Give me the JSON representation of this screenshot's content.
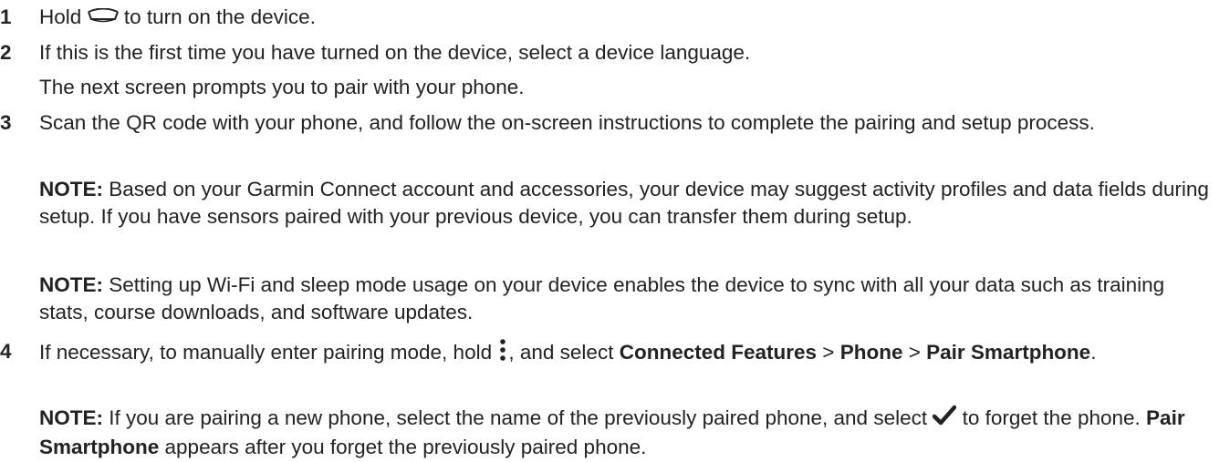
{
  "steps": [
    {
      "number": "1",
      "before_icon": "Hold",
      "icon": "power-button-icon",
      "after_icon": "to turn on the device."
    },
    {
      "number": "2",
      "text": "If this is the first time you have turned on the device, select a device language.",
      "followup": "The next screen prompts you to pair with your phone."
    },
    {
      "number": "3",
      "text": "Scan the QR code with your phone, and follow the on-screen instructions to complete the pairing and setup process.",
      "notes": [
        {
          "label": "NOTE:",
          "text": "Based on your Garmin Connect account and accessories, your device may suggest activity profiles and data fields during setup. If you have sensors paired with your previous device, you can transfer them during setup."
        },
        {
          "label": "NOTE:",
          "text": "Setting up Wi-Fi and sleep mode usage on your device enables the device to sync with all your data such as training stats, course downloads, and software updates."
        }
      ]
    },
    {
      "number": "4",
      "before_icon": "If necessary, to manually enter pairing mode, hold",
      "icon": "menu-dots-icon",
      "mid_text": ", and select",
      "menu_path": [
        "Connected Features",
        "Phone",
        "Pair Smartphone"
      ],
      "separator": ">",
      "end": ".",
      "note": {
        "label": "NOTE:",
        "text_before": "If you are pairing a new phone, select the name of the previously paired phone, and select",
        "icon": "checkmark-icon",
        "text_after": "to forget the phone.",
        "bold_term": "Pair Smartphone",
        "text_end": "appears after you forget the previously paired phone."
      }
    }
  ]
}
